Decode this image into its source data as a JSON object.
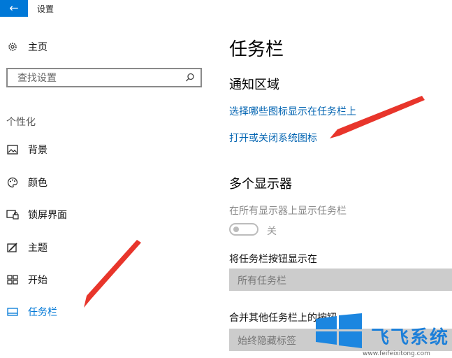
{
  "window": {
    "title": "设置",
    "back_symbol": "←"
  },
  "sidebar": {
    "home_label": "主页",
    "search_placeholder": "查找设置",
    "section_header": "个性化",
    "items": [
      {
        "label": "背景",
        "icon": "image-icon"
      },
      {
        "label": "颜色",
        "icon": "palette-icon"
      },
      {
        "label": "锁屏界面",
        "icon": "lockscreen-icon"
      },
      {
        "label": "主题",
        "icon": "theme-brush-icon"
      },
      {
        "label": "开始",
        "icon": "start-tiles-icon"
      },
      {
        "label": "任务栏",
        "icon": "taskbar-icon",
        "active": true
      }
    ]
  },
  "main": {
    "title": "任务栏",
    "notification_area": {
      "heading": "通知区域",
      "link1": "选择哪些图标显示在任务栏上",
      "link2": "打开或关闭系统图标"
    },
    "multi_display": {
      "heading": "多个显示器",
      "show_all_label": "在所有显示器上显示任务栏",
      "toggle_state": "关",
      "buttons_show_label": "将任务栏按钮显示在",
      "buttons_show_value": "所有任务栏",
      "combine_label": "合并其他任务栏上的按钮",
      "combine_value": "始终隐藏标签"
    }
  },
  "watermark": {
    "brand": "飞飞系统",
    "url": "www.feifeixitong.com"
  },
  "colors": {
    "accent": "#0078d7",
    "link": "#0063b1",
    "arrow": "#e8352b",
    "dropdown_bg": "#cccccc"
  }
}
